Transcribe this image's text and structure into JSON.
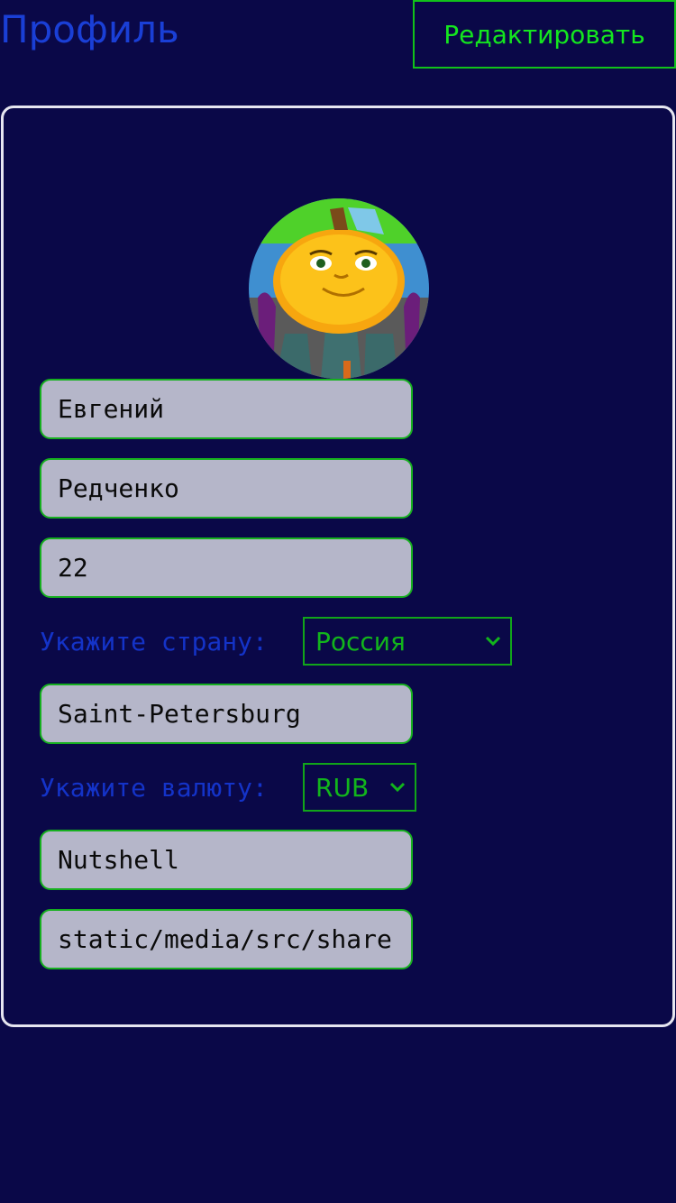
{
  "header": {
    "title": "Профиль",
    "edit_label": "Редактировать"
  },
  "profile": {
    "avatar_icon": "pumpkin-character-avatar",
    "first_name": "Евгений",
    "last_name": "Редченко",
    "age": "22",
    "country_label": "Укажите страну:",
    "country_value": "Россия",
    "city": "Saint-Petersburg",
    "currency_label": "Укажите валюту:",
    "currency_value": "RUB",
    "nickname": "Nutshell",
    "avatar_path": "static/media/src/share"
  },
  "colors": {
    "background": "#0a0848",
    "accent_green": "#14e61f",
    "title_blue": "#1a3fd6",
    "field_bg": "#b5b6c9"
  }
}
